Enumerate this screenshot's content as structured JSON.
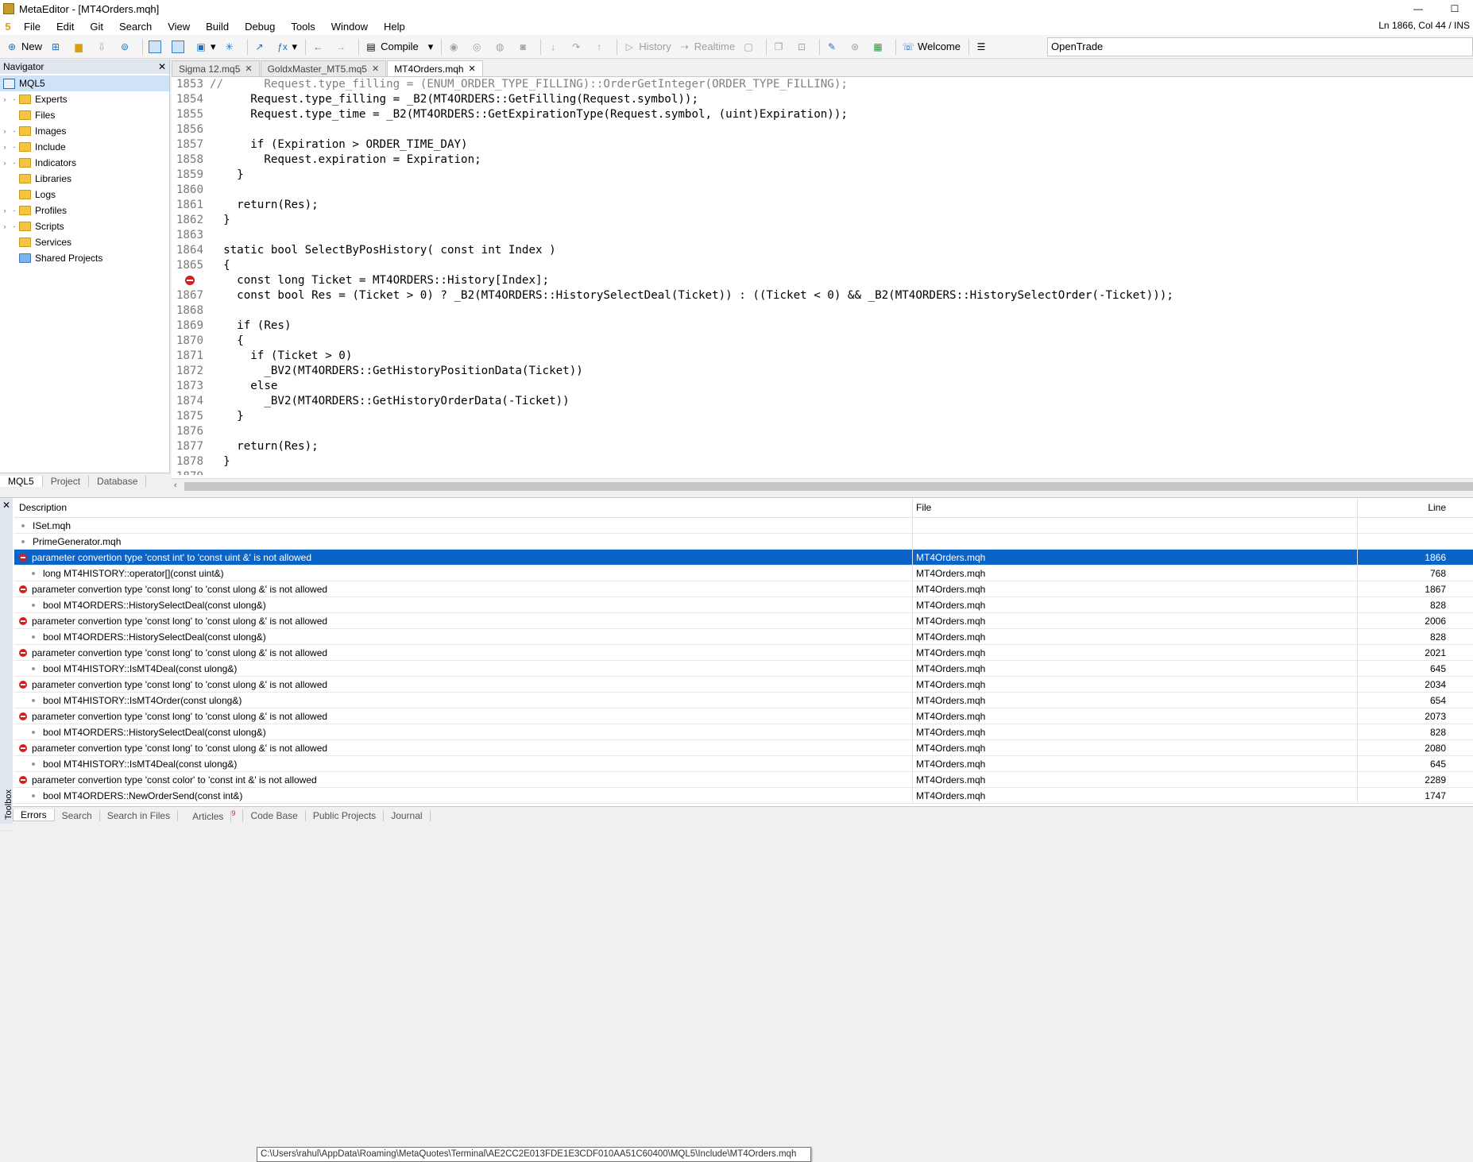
{
  "window": {
    "title": "MetaEditor - [MT4Orders.mqh]",
    "minimize": "—",
    "maximize": "☐"
  },
  "menu": {
    "items": [
      "File",
      "Edit",
      "Git",
      "Search",
      "View",
      "Build",
      "Debug",
      "Tools",
      "Window",
      "Help"
    ],
    "cursor_pos": "Ln 1866, Col 44 / INS"
  },
  "toolbar": {
    "new": "New",
    "compile": "Compile",
    "history": "History",
    "realtime": "Realtime",
    "welcome": "Welcome",
    "search_value": "OpenTrade"
  },
  "navigator": {
    "title": "Navigator",
    "root": "MQL5",
    "items": [
      "Experts",
      "Files",
      "Images",
      "Include",
      "Indicators",
      "Libraries",
      "Logs",
      "Profiles",
      "Scripts",
      "Services",
      "Shared Projects"
    ],
    "tabs": [
      "MQL5",
      "Project",
      "Database"
    ]
  },
  "editor": {
    "tabs": [
      "Sigma 12.mq5",
      "GoldxMaster_MT5.mq5",
      "MT4Orders.mqh"
    ],
    "lines": [
      {
        "n": "1853",
        "t": "//      Request.type_filling = (ENUM_ORDER_TYPE_FILLING)::OrderGetInteger(ORDER_TYPE_FILLING);"
      },
      {
        "n": "1854",
        "t": "      Request.type_filling = _B2(MT4ORDERS::GetFilling(Request.symbol));"
      },
      {
        "n": "1855",
        "t": "      Request.type_time = _B2(MT4ORDERS::GetExpirationType(Request.symbol, (uint)Expiration));"
      },
      {
        "n": "1856",
        "t": ""
      },
      {
        "n": "1857",
        "t": "      if (Expiration > ORDER_TIME_DAY)"
      },
      {
        "n": "1858",
        "t": "        Request.expiration = Expiration;"
      },
      {
        "n": "1859",
        "t": "    }"
      },
      {
        "n": "1860",
        "t": ""
      },
      {
        "n": "1861",
        "t": "    return(Res);"
      },
      {
        "n": "1862",
        "t": "  }"
      },
      {
        "n": "1863",
        "t": ""
      },
      {
        "n": "1864",
        "t": "  static bool SelectByPosHistory( const int Index )"
      },
      {
        "n": "1865",
        "t": "  {"
      },
      {
        "n": "",
        "t": "    const long Ticket = MT4ORDERS::History[Index];"
      },
      {
        "n": "1867",
        "t": "    const bool Res = (Ticket > 0) ? _B2(MT4ORDERS::HistorySelectDeal(Ticket)) : ((Ticket < 0) && _B2(MT4ORDERS::HistorySelectOrder(-Ticket)));"
      },
      {
        "n": "1868",
        "t": ""
      },
      {
        "n": "1869",
        "t": "    if (Res)"
      },
      {
        "n": "1870",
        "t": "    {"
      },
      {
        "n": "1871",
        "t": "      if (Ticket > 0)"
      },
      {
        "n": "1872",
        "t": "        _BV2(MT4ORDERS::GetHistoryPositionData(Ticket))"
      },
      {
        "n": "1873",
        "t": "      else"
      },
      {
        "n": "1874",
        "t": "        _BV2(MT4ORDERS::GetHistoryOrderData(-Ticket))"
      },
      {
        "n": "1875",
        "t": "    }"
      },
      {
        "n": "1876",
        "t": ""
      },
      {
        "n": "1877",
        "t": "    return(Res);"
      },
      {
        "n": "1878",
        "t": "  }"
      },
      {
        "n": "1879",
        "t": ""
      }
    ]
  },
  "errors": {
    "headers": {
      "description": "Description",
      "file": "File",
      "line": "Line"
    },
    "rows": [
      {
        "type": "dot",
        "desc": "ISet.mqh",
        "file": "",
        "line": ""
      },
      {
        "type": "dot",
        "desc": "PrimeGenerator.mqh",
        "file": "",
        "line": ""
      },
      {
        "type": "error",
        "desc": "parameter convertion type 'const int' to 'const uint &' is not allowed",
        "file": "MT4Orders.mqh",
        "line": "1866",
        "selected": true
      },
      {
        "type": "sub",
        "desc": "long MT4HISTORY::operator[](const uint&)",
        "file": "MT4Orders.mqh",
        "line": "768"
      },
      {
        "type": "error",
        "desc": "parameter convertion type 'const long' to 'const ulong &' is not allowed",
        "file": "MT4Orders.mqh",
        "line": "1867"
      },
      {
        "type": "sub",
        "desc": "bool MT4ORDERS::HistorySelectDeal(const ulong&)",
        "file": "MT4Orders.mqh",
        "line": "828"
      },
      {
        "type": "error",
        "desc": "parameter convertion type 'const long' to 'const ulong &' is not allowed",
        "file": "MT4Orders.mqh",
        "line": "2006"
      },
      {
        "type": "sub",
        "desc": "bool MT4ORDERS::HistorySelectDeal(const ulong&)",
        "file": "MT4Orders.mqh",
        "line": "828"
      },
      {
        "type": "error",
        "desc": "parameter convertion type 'const long' to 'const ulong &' is not allowed",
        "file": "MT4Orders.mqh",
        "line": "2021"
      },
      {
        "type": "sub",
        "desc": "bool MT4HISTORY::IsMT4Deal(const ulong&)",
        "file": "MT4Orders.mqh",
        "line": "645"
      },
      {
        "type": "error",
        "desc": "parameter convertion type 'const long' to 'const ulong &' is not allowed",
        "file": "MT4Orders.mqh",
        "line": "2034"
      },
      {
        "type": "sub",
        "desc": "bool MT4HISTORY::IsMT4Order(const ulong&)",
        "file": "MT4Orders.mqh",
        "line": "654"
      },
      {
        "type": "error",
        "desc": "parameter convertion type 'const long' to 'const ulong &' is not allowed",
        "file": "MT4Orders.mqh",
        "line": "2073"
      },
      {
        "type": "sub",
        "desc": "bool MT4ORDERS::HistorySelectDeal(const ulong&)",
        "file": "MT4Orders.mqh",
        "line": "828"
      },
      {
        "type": "error",
        "desc": "parameter convertion type 'const long' to 'const ulong &' is not allowed",
        "file": "MT4Orders.mqh",
        "line": "2080"
      },
      {
        "type": "sub",
        "desc": "bool MT4HISTORY::IsMT4Deal(const ulong&)",
        "file": "MT4Orders.mqh",
        "line": "645"
      },
      {
        "type": "error",
        "desc": "parameter convertion type 'const color' to 'const int &' is not allowed",
        "file": "MT4Orders.mqh",
        "line": "2289"
      },
      {
        "type": "sub",
        "desc": "bool MT4ORDERS::NewOrderSend(const int&)",
        "file": "MT4Orders.mqh",
        "line": "1747"
      }
    ],
    "tooltip": "C:\\Users\\rahul\\AppData\\Roaming\\MetaQuotes\\Terminal\\AE2CC2E013FDE1E3CDF010AA51C60400\\MQL5\\Include\\MT4Orders.mqh"
  },
  "toolbox": {
    "label": "Toolbox",
    "tabs": [
      "Errors",
      "Search",
      "Search in Files",
      "Articles",
      "Code Base",
      "Public Projects",
      "Journal"
    ],
    "articles_badge": "9"
  }
}
